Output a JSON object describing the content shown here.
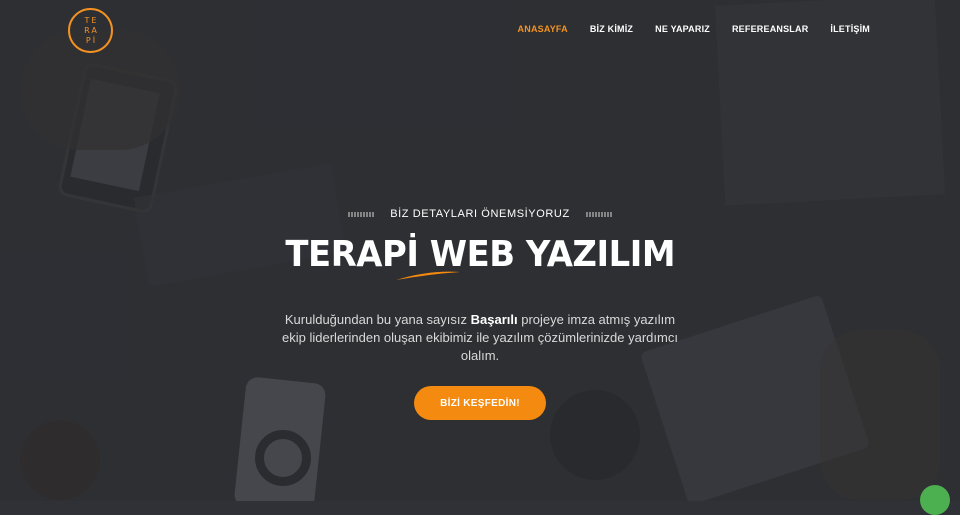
{
  "brand": {
    "logo_lines": [
      "TE",
      "RA",
      "Pİ"
    ],
    "accent_color": "#f39223"
  },
  "nav": {
    "items": [
      {
        "label": "ANASAYFA",
        "active": true
      },
      {
        "label": "BİZ KİMİZ",
        "active": false
      },
      {
        "label": "NE YAPARIZ",
        "active": false
      },
      {
        "label": "REFEREANSLAR",
        "active": false
      },
      {
        "label": "İLETİŞİM",
        "active": false
      }
    ]
  },
  "hero": {
    "eyebrow": "BİZ DETAYLARI ÖNEMSİYORUZ",
    "title": "TERAPİ WEB YAZILIM",
    "desc_before": "Kurulduğundan bu yana sayısız ",
    "desc_bold": "Başarılı",
    "desc_after": " projeye imza atmış yazılım ekip liderlerinden oluşan ekibimiz ile yazılım çözümlerinizde yardımcı olalım.",
    "cta_label": "BİZİ KEŞFEDİN!",
    "cta_color": "#f58a10"
  }
}
